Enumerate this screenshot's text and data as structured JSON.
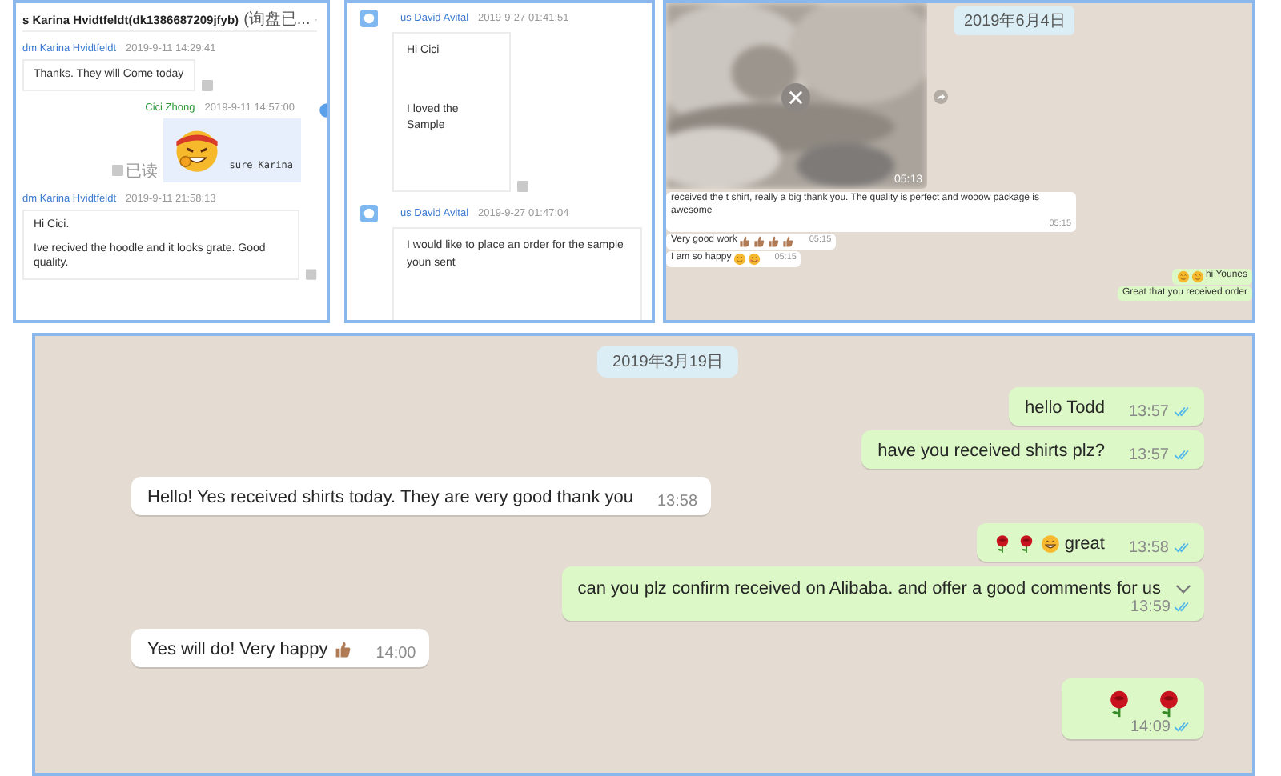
{
  "karina_chat": {
    "header": "s Karina Hvidtfeldt(dk1386687209jfyb)",
    "header_status": "(询盘已...",
    "messages": [
      {
        "kind": "incoming",
        "sender": "dm Karina Hvidtfeldt",
        "time": "2019-9-11 14:29:41",
        "paragraphs": [
          "Thanks. They will Come today"
        ]
      },
      {
        "kind": "outgoing",
        "sender": "Cici Zhong",
        "time": "2019-9-11 14:57:00",
        "sticker": true,
        "paragraphs": [
          "sure  Karina"
        ],
        "status": "已读"
      },
      {
        "kind": "incoming",
        "sender": "dm Karina Hvidtfeldt",
        "time": "2019-9-11 21:58:13",
        "paragraphs": [
          "Hi Cici.",
          "Ive recived the hoodle and it looks grate. Good quality."
        ]
      }
    ]
  },
  "david_chat": {
    "messages": [
      {
        "sender": "us David Avital",
        "time": "2019-9-27 01:41:51",
        "paragraphs": [
          "Hi Cici",
          "I loved the Sample"
        ]
      },
      {
        "sender": "us David Avital",
        "time": "2019-9-27 01:47:04",
        "paragraphs": [
          "I would like to place an order for the sample youn sent"
        ]
      }
    ]
  },
  "video_chat": {
    "video": {
      "kind": "picture",
      "duration": "05:13"
    },
    "date": "2019年6月4日",
    "messages": [
      {
        "kind": "incoming",
        "text": "received the t shirt, really a big thank you.  The quality is perfect and wooow package is awesome",
        "time": "05:15"
      },
      {
        "kind": "incoming",
        "text": "Very good work",
        "emoji": [
          {
            "kind": "thumbs"
          },
          {
            "kind": "thumbs"
          },
          {
            "kind": "thumbs"
          },
          {
            "kind": "thumbs"
          }
        ],
        "time": "05:15"
      },
      {
        "kind": "incoming",
        "text": "I am so happy",
        "emoji": [
          {
            "kind": "smile"
          },
          {
            "kind": "blush"
          }
        ],
        "time": "05:15"
      },
      {
        "kind": "outgoing",
        "emoji_before": [
          {
            "kind": "smile"
          },
          {
            "kind": "smile"
          }
        ],
        "text": "hi Younes"
      },
      {
        "kind": "outgoing",
        "text": "Great that you received order"
      }
    ]
  },
  "main_chat": {
    "date": "2019年3月19日",
    "messages": [
      {
        "kind": "outgoing",
        "text": "hello Todd",
        "time": "13:57",
        "read": true
      },
      {
        "kind": "outgoing",
        "text": "have you received shirts plz?",
        "time": "13:57",
        "read": true
      },
      {
        "kind": "incoming",
        "text": "Hello! Yes received shirts today. They are very good thank you",
        "time": "13:58"
      },
      {
        "kind": "outgoing",
        "emoji_before": [
          {
            "kind": "rose"
          },
          {
            "kind": "rose"
          },
          {
            "kind": "grin"
          }
        ],
        "text": "great",
        "time": "13:58",
        "read": true
      },
      {
        "kind": "outgoing",
        "text": "can you plz confirm received on Alibaba. and offer a good comments for us",
        "time": "13:59",
        "read": true,
        "hovered": true
      },
      {
        "kind": "incoming",
        "text": "Yes will do! Very happy",
        "emoji": [
          {
            "kind": "thumbs"
          }
        ],
        "time": "14:00"
      },
      {
        "kind": "outgoing",
        "emoji_before": [
          {
            "kind": "rose"
          },
          {
            "kind": "rose"
          }
        ],
        "time": "14:09",
        "read": true
      }
    ]
  }
}
